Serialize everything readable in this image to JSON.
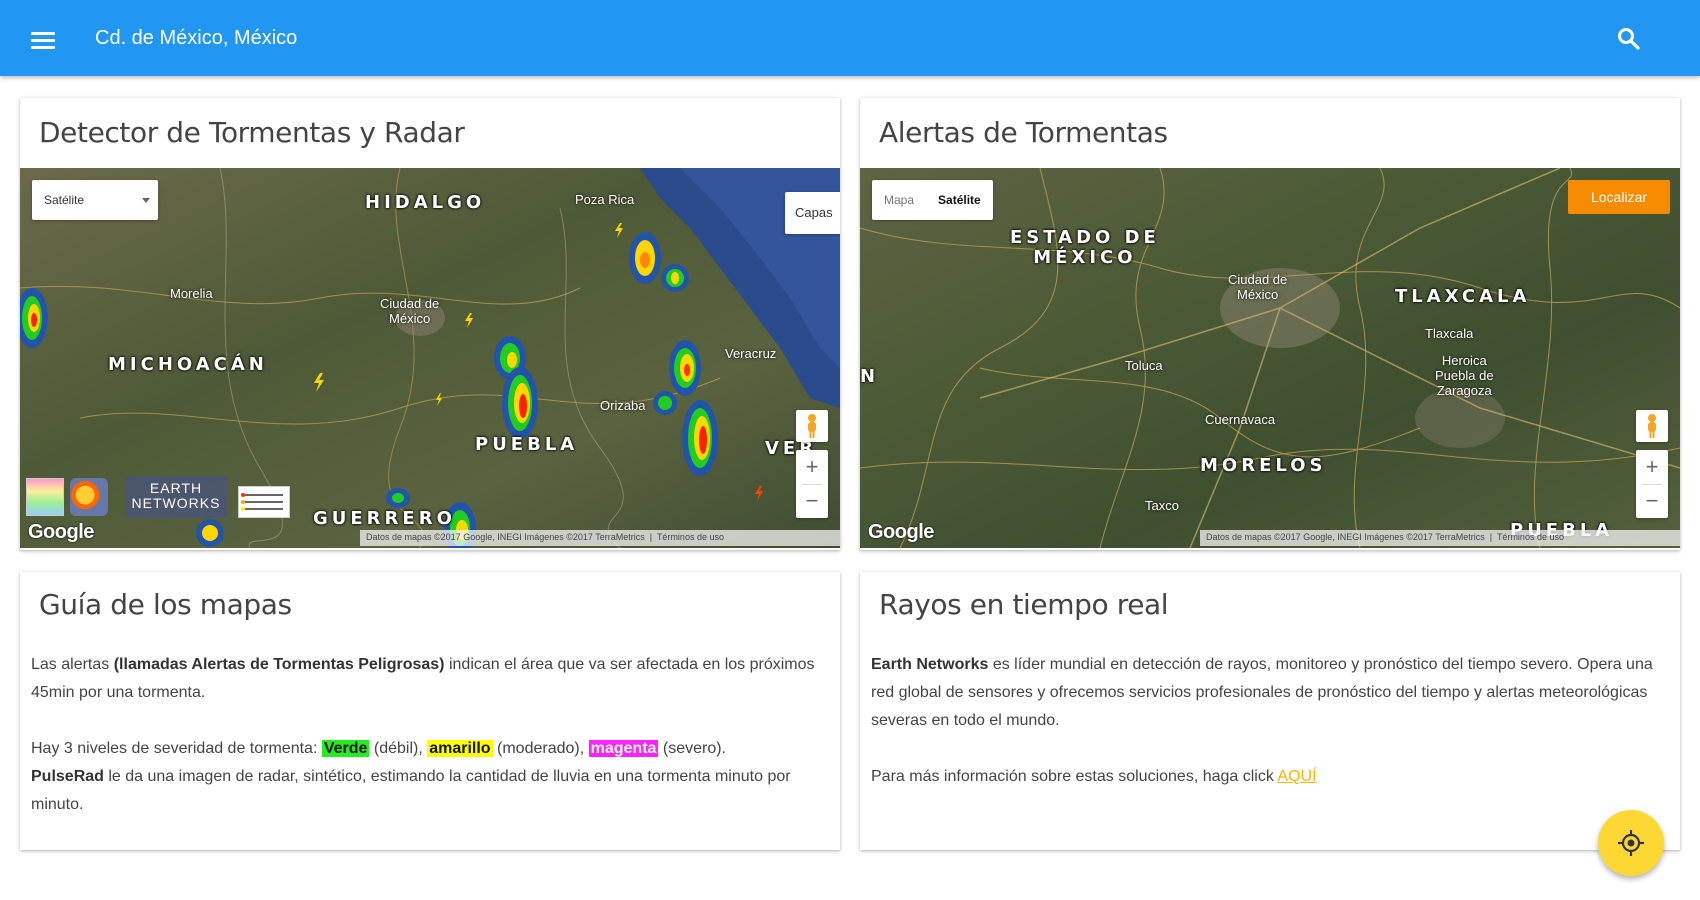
{
  "appbar": {
    "title": "Cd. de México, México",
    "menu_icon": "menu-icon",
    "search_icon": "search-icon",
    "color": "#2196F3"
  },
  "radar_card": {
    "title": "Detector de Tormentas y Radar",
    "map_type_select": "Satélite",
    "layers_button": "Capas",
    "labels": {
      "hidalgo": "HIDALGO",
      "michoacan": "MICHOACÁN",
      "puebla": "PUEBLA",
      "guerrero": "GUERRERO",
      "veracruz": "VER",
      "cdmx": "Ciudad de\nMéxico",
      "poza_rica": "Poza Rica",
      "morelia": "Morelia",
      "veracruz_city": "Veracruz",
      "orizaba": "Orizaba"
    },
    "earth_networks_logo": "EARTH NETWORKS",
    "google_logo": "Google",
    "attribution": "Datos de mapas ©2017 Google, INEGI Imágenes ©2017 TerraMetrics",
    "terms": "Términos de uso",
    "zoom_in": "+",
    "zoom_out": "−"
  },
  "alerts_card": {
    "title": "Alertas de Tormentas",
    "map_type_options": [
      "Mapa",
      "Satélite"
    ],
    "map_type_selected": "Satélite",
    "locate_button": "Localizar",
    "labels": {
      "estado": "ESTADO DE\nMÉXICO",
      "tlaxcala": "TLAXCALA",
      "morelos": "MORELOS",
      "puebla": "PUEBLA",
      "cdmx": "Ciudad de\nMéxico",
      "toluca": "Toluca",
      "cuernavaca": "Cuernavaca",
      "tlaxcala_city": "Tlaxcala",
      "heroica": "Heroica\nPuebla de\nZaragoza",
      "taxco": "Taxco",
      "n_edge": "N"
    },
    "google_logo": "Google",
    "attribution": "Datos de mapas ©2017 Google, INEGI Imágenes ©2017 TerraMetrics",
    "terms": "Términos de uso",
    "zoom_in": "+",
    "zoom_out": "−"
  },
  "guide_card": {
    "title": "Guía de los mapas",
    "p1_pre": "Las alertas ",
    "p1_bold": "(llamadas Alertas de Tormentas Peligrosas)",
    "p1_post": " indican el área que va ser afectada en los próximos 45min por una tormenta.",
    "p2_pre": "Hay 3 niveles de severidad de tormenta: ",
    "level_green": "Verde",
    "level_green_desc": " (débil), ",
    "level_yellow": "amarillo",
    "level_yellow_desc": " (moderado), ",
    "level_magenta": "magenta",
    "level_magenta_desc": " (severo).",
    "p3_bold": "PulseRad",
    "p3_post": " le da una imagen de radar, sintético, estimando la cantidad de lluvia en una tormenta minuto por minuto."
  },
  "lightning_card": {
    "title": "Rayos en tiempo real",
    "p1_bold": "Earth Networks",
    "p1_post": " es líder mundial en detección de rayos, monitoreo y pronóstico del tiempo severo. Opera una red global de sensores y ofrecemos servicios profesionales de pronóstico del tiempo y alertas meteorológicas severas en todo el mundo.",
    "p2_pre": "Para más información sobre estas soluciones, haga click ",
    "p2_link": "AQUÍ"
  },
  "fab": {
    "icon": "my-location-icon",
    "color": "#FDD835"
  }
}
